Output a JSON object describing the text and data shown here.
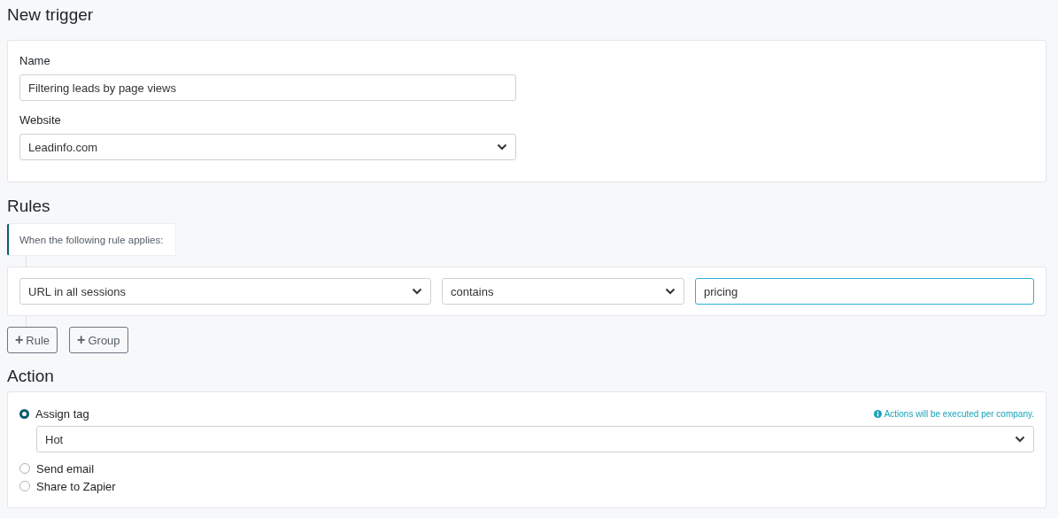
{
  "title": "New trigger",
  "details": {
    "fields": [
      {
        "label": "Name",
        "kind": "text",
        "value": "Filtering leads by page views"
      },
      {
        "label": "Website",
        "kind": "select",
        "value": "Leadinfo.com"
      }
    ]
  },
  "rules": {
    "heading": "Rules",
    "intro": "When the following rule applies:",
    "rule": [
      {
        "kind": "select",
        "value": "URL in all sessions",
        "focused": false
      },
      {
        "kind": "select",
        "value": "contains",
        "focused": false
      },
      {
        "kind": "text",
        "value": "pricing",
        "focused": true
      }
    ],
    "buttons": [
      {
        "icon": "+",
        "label": "Rule"
      },
      {
        "icon": "+",
        "label": "Group"
      }
    ]
  },
  "action": {
    "heading": "Action",
    "note": "Actions will be executed per company.",
    "options": [
      {
        "label": "Assign tag",
        "selected": true
      },
      {
        "label": "Send email",
        "selected": false
      },
      {
        "label": "Share to Zapier",
        "selected": false
      }
    ],
    "tag_select": {
      "kind": "select",
      "value": "Hot"
    }
  }
}
